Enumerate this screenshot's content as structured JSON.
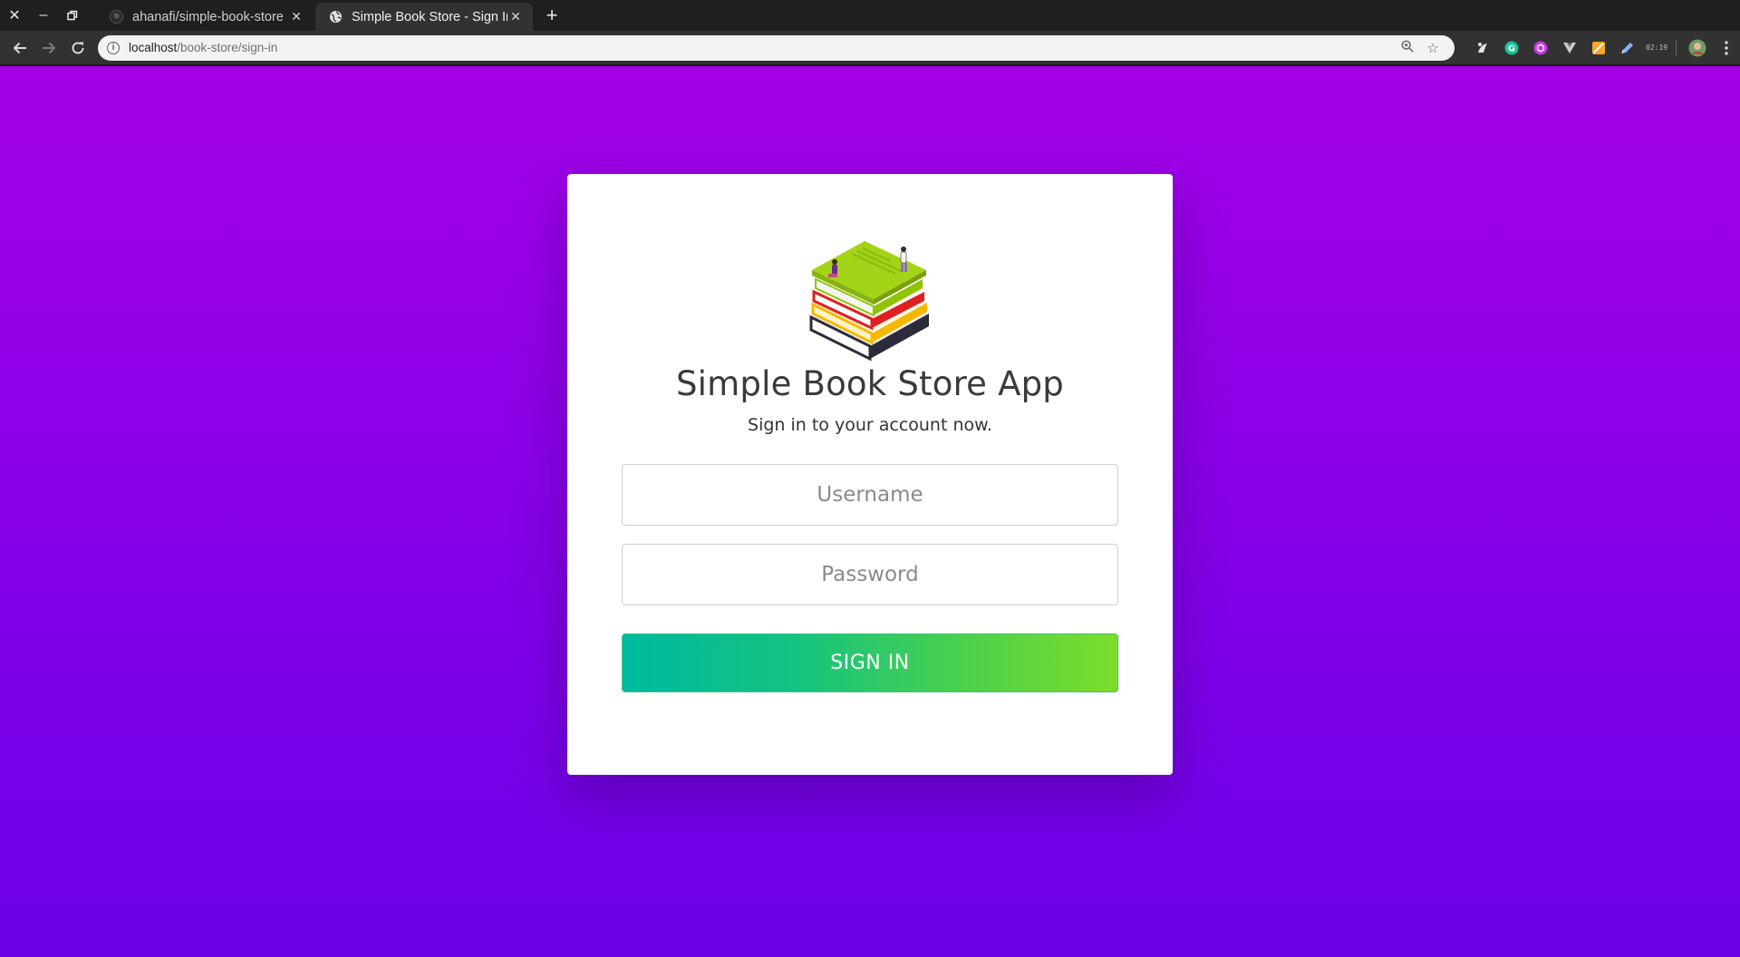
{
  "browser": {
    "tabs": [
      {
        "title": "ahanafi/simple-book-store",
        "favicon": "github-icon",
        "active": false
      },
      {
        "title": "Simple Book Store - Sign In",
        "favicon": "globe-icon",
        "active": true
      }
    ],
    "url_host": "localhost",
    "url_path": "/book-store/sign-in",
    "extensions": [
      "extension-icon-1",
      "grammarly-icon",
      "extension-icon-3",
      "vue-devtools-icon",
      "extension-icon-5",
      "extension-icon-6",
      "clock-extension-icon",
      "profile-avatar"
    ],
    "clock_extension_text": "02:19"
  },
  "login": {
    "logo": "book-stack-logo",
    "title": "Simple Book Store App",
    "subtitle": "Sign in to your account now.",
    "username_placeholder": "Username",
    "username_value": "",
    "password_placeholder": "Password",
    "password_value": "",
    "signin_label": "SIGN IN"
  },
  "colors": {
    "background_top": "#a300e6",
    "background_bottom": "#6b00e8",
    "button_start": "#00b9a0",
    "button_end": "#7ddd2a"
  }
}
